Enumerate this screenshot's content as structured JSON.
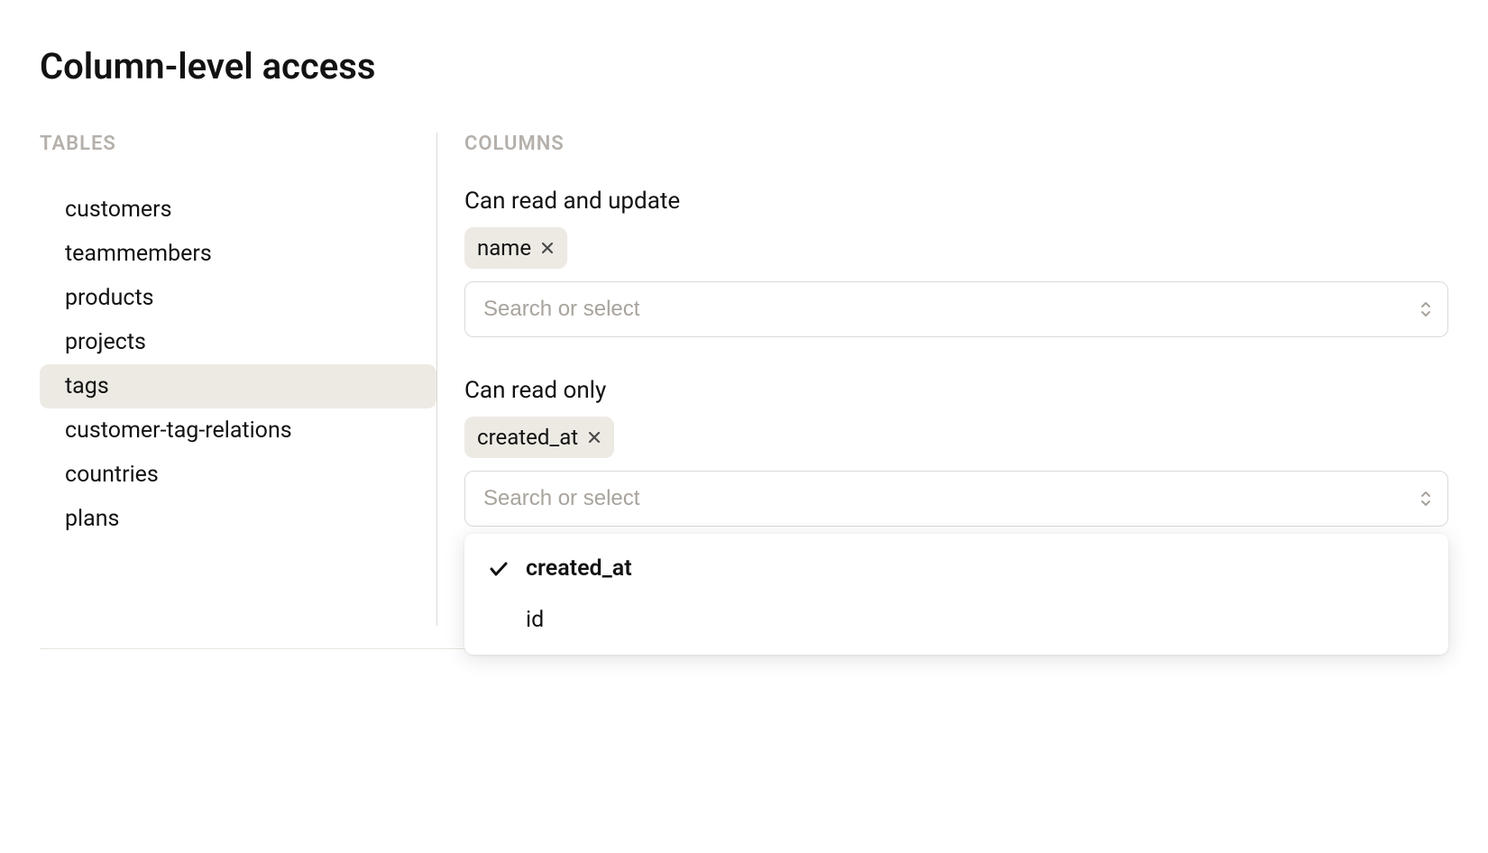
{
  "page": {
    "title": "Column-level access"
  },
  "sidebar": {
    "heading": "TABLES",
    "items": [
      {
        "label": "customers",
        "selected": false
      },
      {
        "label": "teammembers",
        "selected": false
      },
      {
        "label": "products",
        "selected": false
      },
      {
        "label": "projects",
        "selected": false
      },
      {
        "label": "tags",
        "selected": true
      },
      {
        "label": "customer-tag-relations",
        "selected": false
      },
      {
        "label": "countries",
        "selected": false
      },
      {
        "label": "plans",
        "selected": false
      }
    ]
  },
  "columns": {
    "heading": "COLUMNS",
    "read_update": {
      "label": "Can read and update",
      "tags": [
        {
          "label": "name"
        }
      ],
      "placeholder": "Search or select"
    },
    "read_only": {
      "label": "Can read only",
      "tags": [
        {
          "label": "created_at"
        }
      ],
      "placeholder": "Search or select",
      "dropdown_open": true,
      "options": [
        {
          "label": "created_at",
          "selected": true
        },
        {
          "label": "id",
          "selected": false
        }
      ]
    }
  }
}
